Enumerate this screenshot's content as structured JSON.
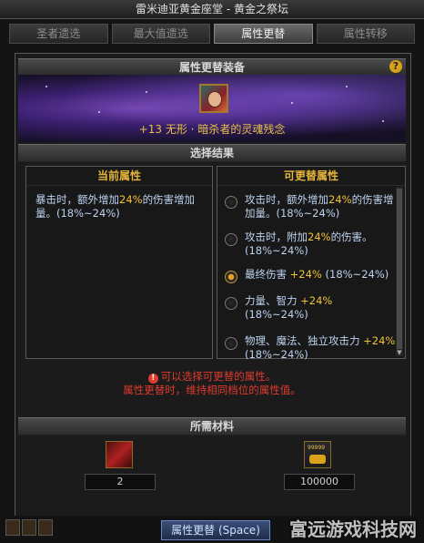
{
  "window": {
    "title": "雷米迪亚黄金座堂 - 黄金之祭坛"
  },
  "tabs": [
    {
      "label": "圣者遗选"
    },
    {
      "label": "最大值遗选"
    },
    {
      "label": "属性更替"
    },
    {
      "label": "属性转移"
    }
  ],
  "equip_section": {
    "header": "属性更替装备",
    "help": "?",
    "item": {
      "plus": "+13",
      "kind": "无形",
      "name": "暗杀者的灵魂残念"
    }
  },
  "result_section": {
    "header": "选择结果"
  },
  "current": {
    "title": "当前属性",
    "text_a": "暴击时，额外增加",
    "value": "24%",
    "text_b": "的伤害增加量。(18%~24%)"
  },
  "options_panel": {
    "title": "可更替属性",
    "options": [
      {
        "a": "攻击时，额外增加",
        "v": "24%",
        "b": "的伤害增加量。(18%~24%)",
        "selected": false
      },
      {
        "a": "攻击时，附加",
        "v": "24%",
        "b": "的伤害。(18%~24%)",
        "selected": false
      },
      {
        "a": "最终伤害 ",
        "v": "+24%",
        "b": " (18%~24%)",
        "selected": true
      },
      {
        "a": "力量、智力 ",
        "v": "+24%",
        "b": " (18%~24%)",
        "selected": false
      },
      {
        "a": "物理、魔法、独立攻击力 ",
        "v": "+24%",
        "b": " (18%~24%)",
        "selected": false
      }
    ]
  },
  "warning": {
    "line1": "可以选择可更替的属性。",
    "line2": "属性更替时，维持相同档位的属性值。"
  },
  "materials": {
    "header": "所需材料",
    "count_a": "2",
    "count_b": "100000",
    "item_b_label": "99999"
  },
  "action": {
    "label": "属性更替 (Space)"
  },
  "watermark": "富远游戏科技网",
  "colors": {
    "highlight": "#f1c232",
    "option_text": "#bdd3f0",
    "warning": "#e03b2e"
  }
}
